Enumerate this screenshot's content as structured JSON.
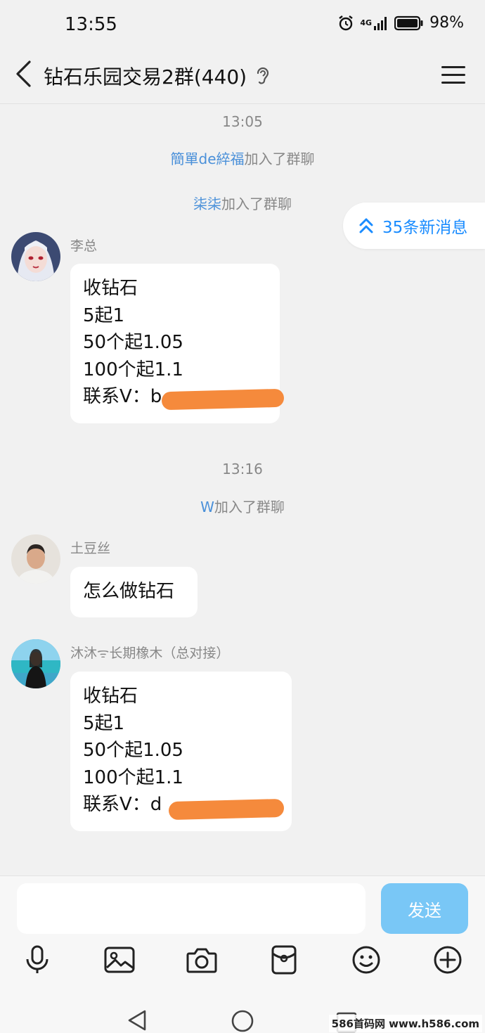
{
  "status_bar": {
    "time": "13:55",
    "network": "4G",
    "battery": "98%"
  },
  "header": {
    "title": "钻石乐园交易2群(440)"
  },
  "chat": {
    "new_messages": "35条新消息",
    "time_1": "13:05",
    "join_1_name": "簡單de綷福",
    "join_1_suffix": "加入了群聊",
    "join_2_name": "柒柒",
    "join_2_suffix": "加入了群聊",
    "msg_1": {
      "sender": "李总",
      "lines": [
        "收钻石",
        "5起1",
        "50个起1.05",
        "100个起1.1",
        "联系V：b"
      ]
    },
    "time_2": "13:16",
    "join_3_name": "W",
    "join_3_suffix": "加入了群聊",
    "msg_2": {
      "sender": "土豆丝",
      "text": "怎么做钻石"
    },
    "msg_3": {
      "sender": "沐沐ᯤ长期橡木（总对接）",
      "lines": [
        "收钻石",
        "5起1",
        "50个起1.05",
        "100个起1.1",
        "联系V：d"
      ]
    }
  },
  "input": {
    "placeholder": "",
    "send_label": "发送"
  },
  "watermark": "586首码网 www.h586.com",
  "colors": {
    "accent": "#1a8cff",
    "send_button": "#79c7f6",
    "nickname": "#4a90d9",
    "redaction": "#f58a3c"
  }
}
